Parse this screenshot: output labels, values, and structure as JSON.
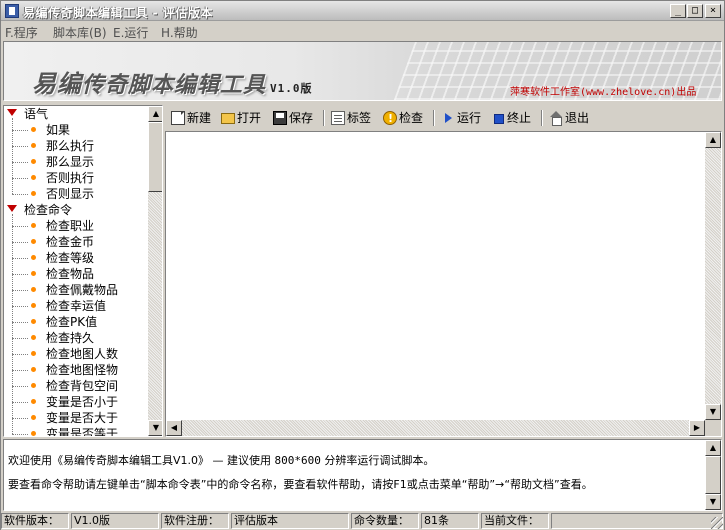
{
  "window": {
    "title": "易编传奇脚本编辑工具 - 评估版本",
    "controls": {
      "minimize": "_",
      "maximize": "□",
      "close": "×"
    }
  },
  "menu": [
    {
      "label": "F.程序"
    },
    {
      "label": "脚本库(B)"
    },
    {
      "label": "E.运行"
    },
    {
      "label": "H.帮助"
    }
  ],
  "banner": {
    "title_big": "易编",
    "title_rest": "传奇脚本编辑工具",
    "version": "V1.0版",
    "credit_name": "萍寒软件工作室",
    "credit_url": "(www.zhelove.cn)",
    "credit_suffix": "出品"
  },
  "tree": {
    "categories": [
      {
        "label": "语气",
        "children": [
          "如果",
          "那么执行",
          "那么显示",
          "否则执行",
          "否则显示"
        ]
      },
      {
        "label": "检查命令",
        "children": [
          "检查职业",
          "检查金币",
          "检查等级",
          "检查物品",
          "检查佩戴物品",
          "检查幸运值",
          "检查PK值",
          "检查持久",
          "检查地图人数",
          "检查地图怪物",
          "检查背包空间",
          "变量是否小于",
          "变量是否大于",
          "变量是否等于"
        ]
      }
    ]
  },
  "toolbar": {
    "new": "新建",
    "open": "打开",
    "save": "保存",
    "tag": "标签",
    "check": "检查",
    "run": "运行",
    "stop": "终止",
    "exit": "退出"
  },
  "editor": {
    "content": ""
  },
  "messages": {
    "line1_a": "欢迎使用《易编传奇脚本编辑工具V1.0》 — 建议使用 ",
    "line1_res": "800*600",
    "line1_b": " 分辨率运行调试脚本。",
    "line2": "要查看命令帮助请左键单击“脚本命令表”中的命令名称，要查看软件帮助，请按F1或点击菜单“帮助”→“帮助文档”查看。"
  },
  "status": {
    "version_label": "软件版本：",
    "version_value": "V1.0版",
    "reg_label": "软件注册：",
    "reg_value": "评估版本",
    "count_label": "命令数量：",
    "count_value": "81条",
    "file_label": "当前文件：",
    "file_value": ""
  }
}
